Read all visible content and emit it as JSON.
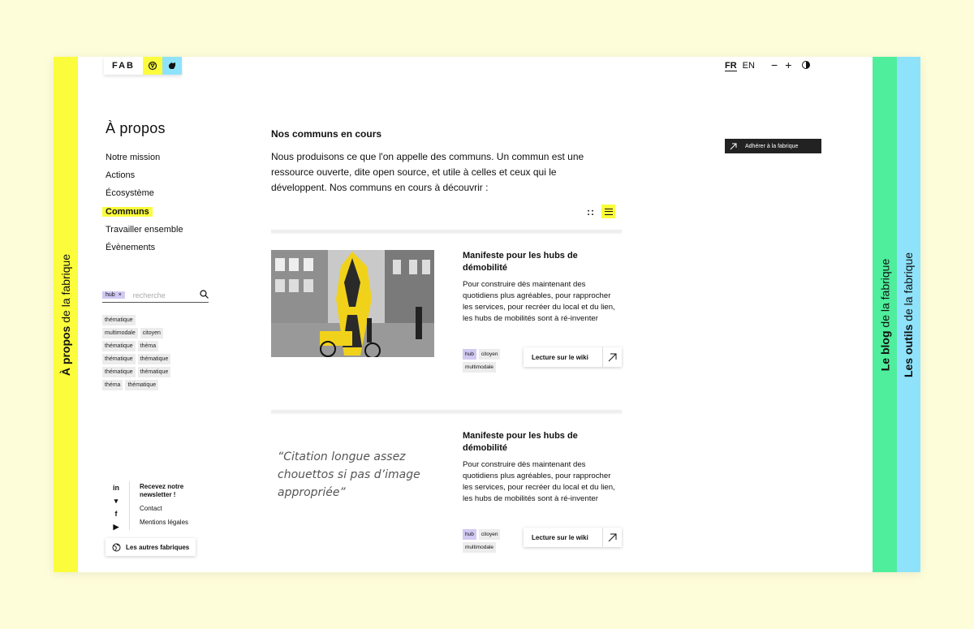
{
  "logo": {
    "text": "FAB"
  },
  "lang": {
    "active": "FR",
    "other": "EN"
  },
  "zoom": {
    "minus": "−",
    "plus": "+"
  },
  "tabs": {
    "left": {
      "bold": "À propos",
      "rest": " de la fabrique"
    },
    "green": {
      "bold": "Le blog",
      "rest": " de la fabrique"
    },
    "blue": {
      "bold": "Les outils",
      "rest": " de la fabrique"
    }
  },
  "sidebar": {
    "title": "À propos",
    "items": [
      {
        "label": "Notre mission"
      },
      {
        "label": "Actions"
      },
      {
        "label": "Écosystème"
      },
      {
        "label": "Communs"
      },
      {
        "label": "Travailler ensemble"
      },
      {
        "label": "Évènements"
      }
    ],
    "active_index": 3
  },
  "search": {
    "chip": "hub",
    "chip_close": "×",
    "placeholder": "recherche"
  },
  "filter_tags": [
    [
      "thématique"
    ],
    [
      "multimodale",
      "citoyen"
    ],
    [
      "thématique",
      "théma"
    ],
    [
      "thématique",
      "thématique"
    ],
    [
      "thématique",
      "thématique"
    ],
    [
      "théma",
      "thématique"
    ]
  ],
  "footer": {
    "social": [
      "in",
      "▾",
      "f",
      "▶"
    ],
    "newsletter": "Recevez notre newsletter !",
    "contact": "Contact",
    "legal": "Mentions légales",
    "others": "Les autres fabriques"
  },
  "main": {
    "title": "Nos communs en cours",
    "intro": "Nous produisons ce que l'on appelle des communs. Un commun est une ressource ouverte, dite open source, et utile à celles et ceux qui le développent. Nos communs en cours à découvrir :",
    "grid_toggle": "::"
  },
  "cards": [
    {
      "title": "Manifeste pour les hubs de démobilité",
      "description": "Pour construire dès maintenant des quotidiens plus agréables, pour rapprocher les services, pour recréer du local et du lien, les hubs de mobilités sont à ré-inventer",
      "tags": [
        "hub",
        "citoyen",
        "multimodale"
      ],
      "button": "Lecture sur le wiki"
    },
    {
      "quote": "“Citation longue assez chouettos si pas d’image appropriée”",
      "title": "Manifeste pour les hubs de démobilité",
      "description": "Pour construire dès maintenant des quotidiens plus agréables, pour rapprocher les services, pour recréer du local et du lien, les hubs de mobilités sont à ré-inventer",
      "tags": [
        "hub",
        "citoyen",
        "multimodale"
      ],
      "button": "Lecture sur le wiki"
    }
  ],
  "cta": {
    "label": "Adhérer à la fabrique"
  },
  "colors": {
    "yellow": "#fbfd3c",
    "green": "#4fee9c",
    "blue": "#8ee3fb",
    "lavender": "#d2c9f3"
  }
}
